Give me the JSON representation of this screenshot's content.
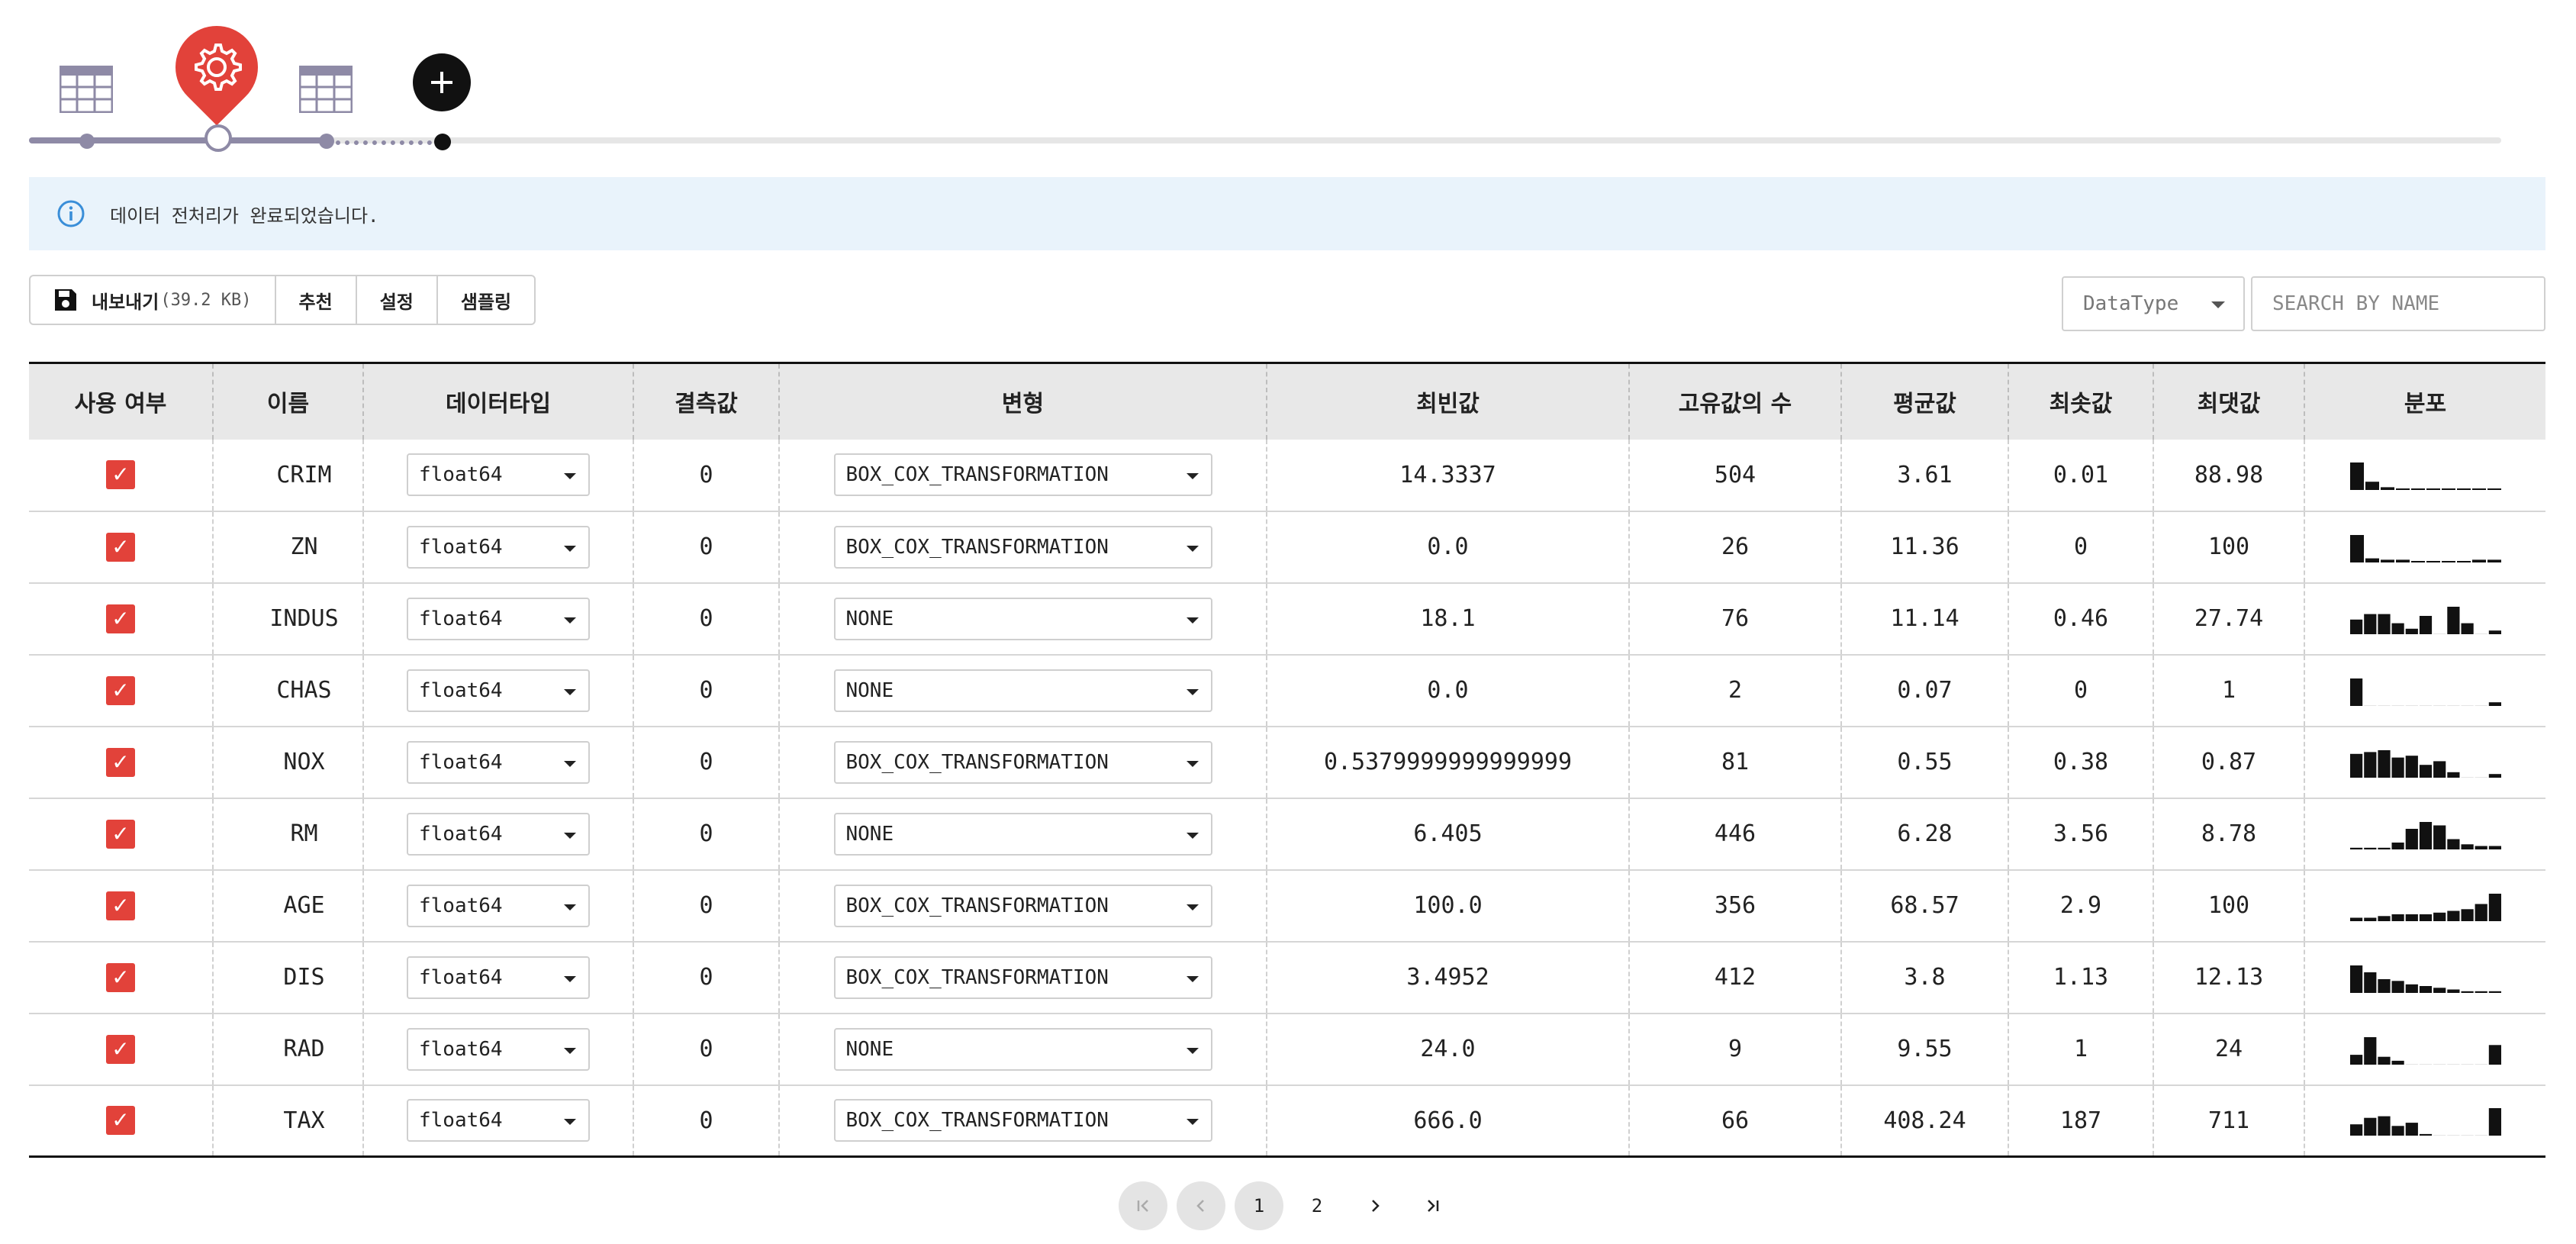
{
  "pipeline": {
    "steps": [
      {
        "name": "source-table",
        "icon": "table-icon"
      },
      {
        "name": "preprocess",
        "icon": "gear-icon",
        "active": true
      },
      {
        "name": "output-table",
        "icon": "table-icon"
      },
      {
        "name": "add-step",
        "icon": "plus-icon"
      }
    ],
    "colors": {
      "done": "#8e8aa6",
      "active": "#e2423a",
      "pending": "#e6e6e6"
    }
  },
  "notice": {
    "icon": "info-icon",
    "text": "데이터 전처리가 완료되었습니다."
  },
  "toolbar": {
    "export_label": "내보내기",
    "export_size": "(39.2 KB)",
    "recommend_label": "추천",
    "settings_label": "설정",
    "sampling_label": "샘플링",
    "dtype_filter": "DataType",
    "search_placeholder": "SEARCH BY NAME"
  },
  "table": {
    "headers": [
      "사용 여부",
      "이름",
      "데이터타입",
      "결측값",
      "변형",
      "최빈값",
      "고유값의 수",
      "평균값",
      "최솟값",
      "최댓값",
      "분포"
    ],
    "rows": [
      {
        "use": true,
        "name": "CRIM",
        "dtype": "float64",
        "missing": "0",
        "transform": "BOX_COX_TRANSFORMATION",
        "mode": "14.3337",
        "unique": "504",
        "mean": "3.61",
        "min": "0.01",
        "max": "88.98",
        "dist": [
          20,
          6,
          2,
          1,
          1,
          1,
          1,
          1,
          1,
          1
        ]
      },
      {
        "use": true,
        "name": "ZN",
        "dtype": "float64",
        "missing": "0",
        "transform": "BOX_COX_TRANSFORMATION",
        "mode": "0.0",
        "unique": "26",
        "mean": "11.36",
        "min": "0",
        "max": "100",
        "dist": [
          20,
          3,
          2,
          2,
          1,
          1,
          1,
          1,
          2,
          2
        ]
      },
      {
        "use": true,
        "name": "INDUS",
        "dtype": "float64",
        "missing": "0",
        "transform": "NONE",
        "mode": "18.1",
        "unique": "76",
        "mean": "11.14",
        "min": "0.46",
        "max": "27.74",
        "dist": [
          8,
          11,
          11,
          6,
          3,
          10,
          0,
          15,
          6,
          0,
          2
        ]
      },
      {
        "use": true,
        "name": "CHAS",
        "dtype": "float64",
        "missing": "0",
        "transform": "NONE",
        "mode": "0.0",
        "unique": "2",
        "mean": "0.07",
        "min": "0",
        "max": "1",
        "dist": [
          15,
          0,
          0,
          0,
          0,
          0,
          0,
          0,
          0,
          0,
          2
        ]
      },
      {
        "use": true,
        "name": "NOX",
        "dtype": "float64",
        "missing": "0",
        "transform": "BOX_COX_TRANSFORMATION",
        "mode": "0.5379999999999999",
        "unique": "81",
        "mean": "0.55",
        "min": "0.38",
        "max": "0.87",
        "dist": [
          13,
          14,
          15,
          11,
          12,
          7,
          9,
          3,
          0,
          0,
          2
        ]
      },
      {
        "use": true,
        "name": "RM",
        "dtype": "float64",
        "missing": "0",
        "transform": "NONE",
        "mode": "6.405",
        "unique": "446",
        "mean": "6.28",
        "min": "3.56",
        "max": "8.78",
        "dist": [
          1,
          1,
          1,
          4,
          12,
          16,
          14,
          6,
          3,
          2,
          2
        ]
      },
      {
        "use": true,
        "name": "AGE",
        "dtype": "float64",
        "missing": "0",
        "transform": "BOX_COX_TRANSFORMATION",
        "mode": "100.0",
        "unique": "356",
        "mean": "68.57",
        "min": "2.9",
        "max": "100",
        "dist": [
          2,
          2,
          3,
          4,
          4,
          4,
          5,
          6,
          7,
          10,
          16
        ]
      },
      {
        "use": true,
        "name": "DIS",
        "dtype": "float64",
        "missing": "0",
        "transform": "BOX_COX_TRANSFORMATION",
        "mode": "3.4952",
        "unique": "412",
        "mean": "3.8",
        "min": "1.13",
        "max": "12.13",
        "dist": [
          16,
          12,
          8,
          7,
          5,
          4,
          3,
          2,
          1,
          1,
          1
        ]
      },
      {
        "use": true,
        "name": "RAD",
        "dtype": "float64",
        "missing": "0",
        "transform": "NONE",
        "mode": "24.0",
        "unique": "9",
        "mean": "9.55",
        "min": "1",
        "max": "24",
        "dist": [
          5,
          14,
          4,
          2,
          0,
          0,
          0,
          0,
          0,
          0,
          10
        ]
      },
      {
        "use": true,
        "name": "TAX",
        "dtype": "float64",
        "missing": "0",
        "transform": "BOX_COX_TRANSFORMATION",
        "mode": "666.0",
        "unique": "66",
        "mean": "408.24",
        "min": "187",
        "max": "711",
        "dist": [
          7,
          11,
          12,
          6,
          8,
          1,
          0,
          0,
          0,
          0,
          17
        ]
      }
    ]
  },
  "pagination": {
    "pages": [
      "1",
      "2"
    ],
    "current": "1",
    "first_icon": "first-page-icon",
    "prev_icon": "prev-page-icon",
    "next_icon": "next-page-icon",
    "last_icon": "last-page-icon"
  },
  "colors": {
    "accent": "#e2423a",
    "notice_bg": "#e9f3fb",
    "header_bg": "#e8e8e8",
    "info_icon": "#3a8ed8"
  }
}
